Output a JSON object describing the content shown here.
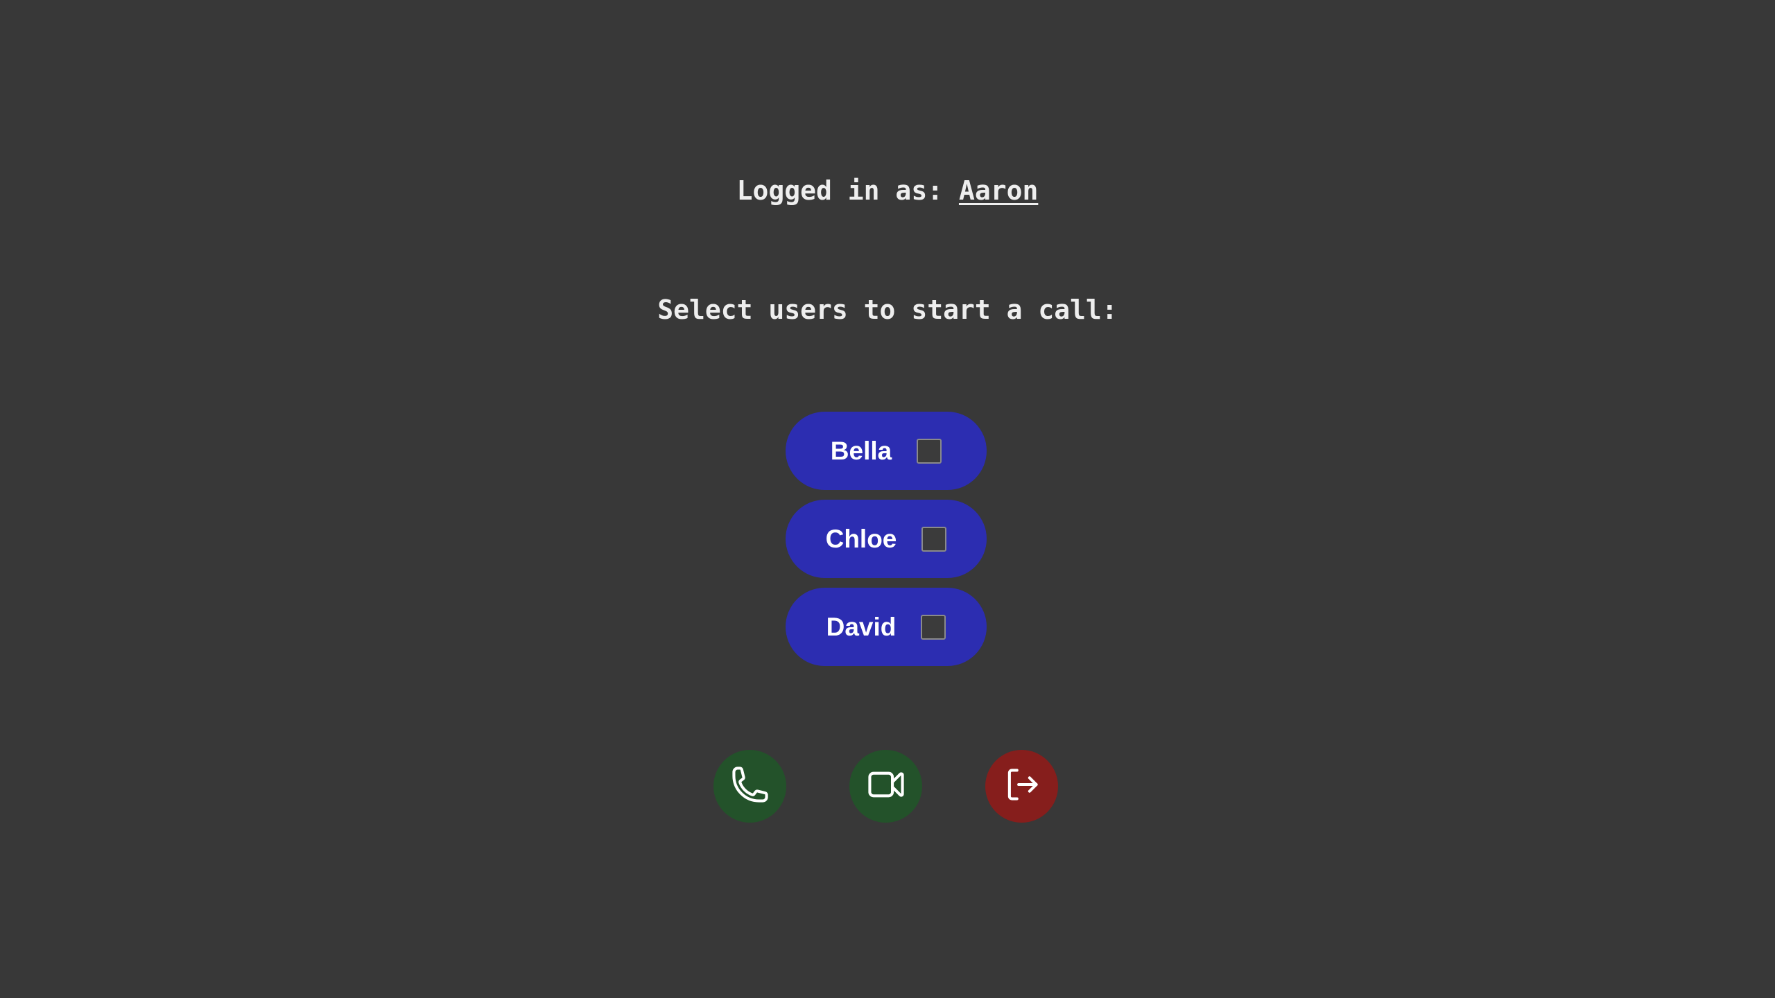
{
  "session": {
    "label": "Logged in as: ",
    "username": "Aaron"
  },
  "prompt": "Select users to start a call:",
  "users": [
    {
      "name": "Bella",
      "checked": false
    },
    {
      "name": "Chloe",
      "checked": false
    },
    {
      "name": "David",
      "checked": false
    }
  ],
  "actions": [
    {
      "icon": "phone-icon",
      "color": "#23522a"
    },
    {
      "icon": "video-camera-icon",
      "color": "#23522a"
    },
    {
      "icon": "logout-icon",
      "color": "#861e1c"
    }
  ],
  "colors": {
    "background": "#383838",
    "user_pill": "#2c2db1",
    "call_button": "#23522a",
    "logout_button": "#861e1c"
  }
}
